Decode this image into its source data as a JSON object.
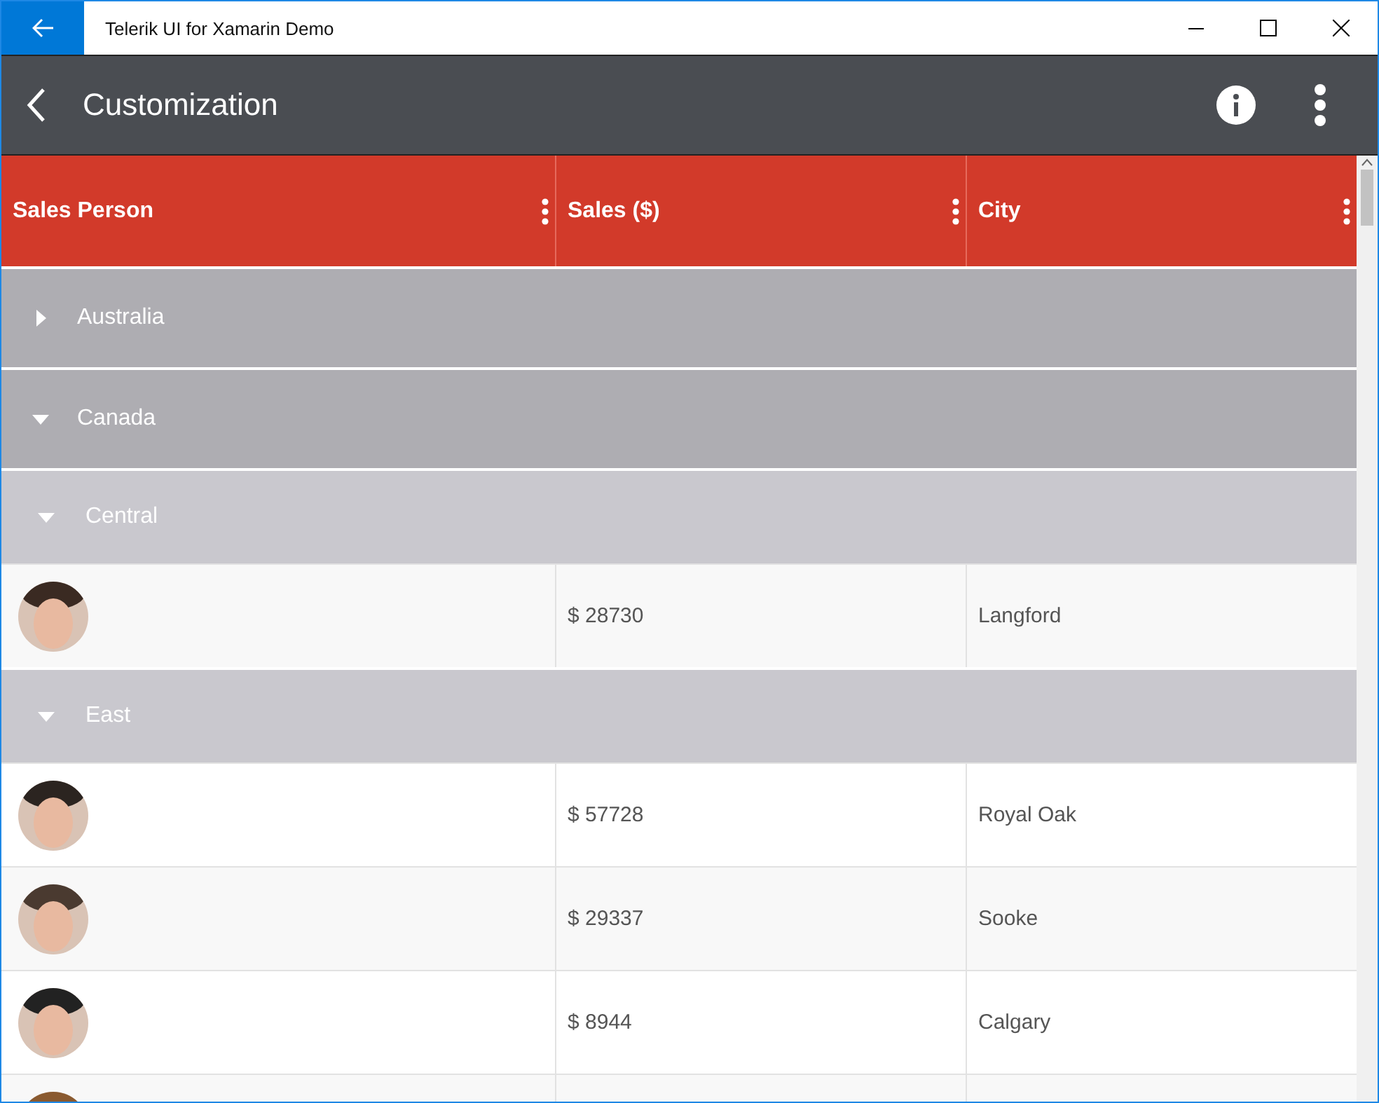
{
  "window": {
    "title": "Telerik UI for Xamarin Demo"
  },
  "app_bar": {
    "title": "Customization"
  },
  "table": {
    "columns": [
      {
        "label": "Sales Person"
      },
      {
        "label": "Sales ($)"
      },
      {
        "label": "City"
      }
    ],
    "groups": [
      {
        "label": "Australia",
        "expanded": false
      },
      {
        "label": "Canada",
        "expanded": true,
        "children": [
          {
            "label": "Central",
            "expanded": true,
            "rows": [
              {
                "sales": "$ 28730",
                "city": "Langford"
              }
            ]
          },
          {
            "label": "East",
            "expanded": true,
            "rows": [
              {
                "sales": "$ 57728",
                "city": "Royal Oak"
              },
              {
                "sales": "$ 29337",
                "city": "Sooke"
              },
              {
                "sales": "$ 8944",
                "city": "Calgary"
              },
              {
                "partial": true
              }
            ]
          }
        ]
      }
    ]
  }
}
